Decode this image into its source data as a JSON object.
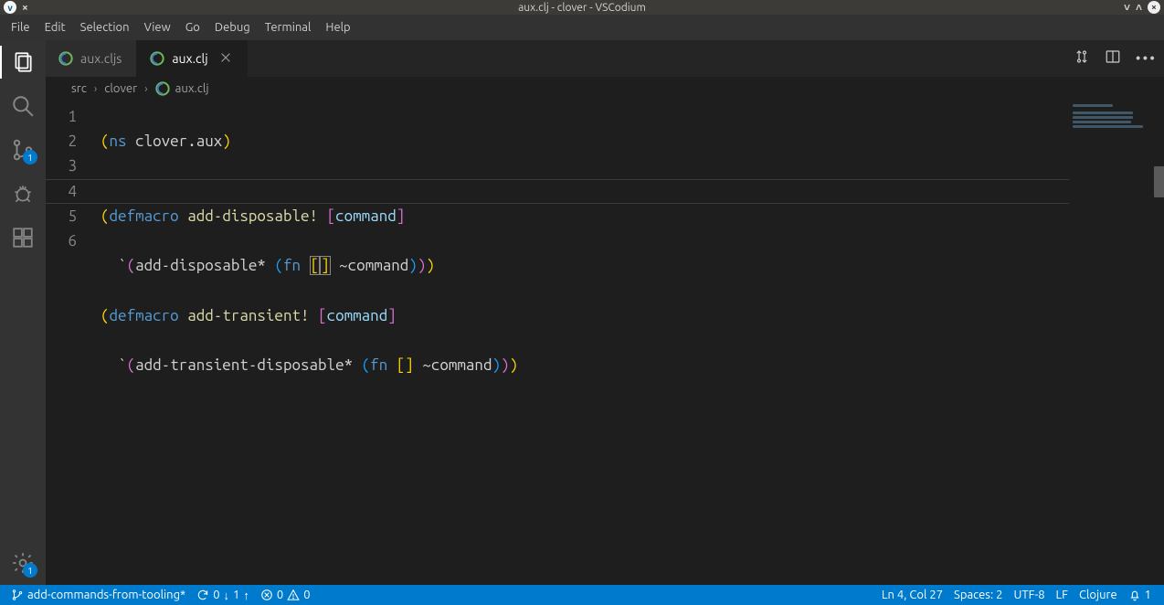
{
  "window": {
    "title": "aux.clj - clover - VSCodium"
  },
  "menu": [
    "File",
    "Edit",
    "Selection",
    "View",
    "Go",
    "Debug",
    "Terminal",
    "Help"
  ],
  "activity": {
    "scm_badge": "1",
    "settings_badge": "1"
  },
  "tabs": [
    {
      "label": "aux.cljs",
      "active": false,
      "icon": "clojure-icon"
    },
    {
      "label": "aux.clj",
      "active": true,
      "icon": "clojure-icon"
    }
  ],
  "breadcrumb": {
    "parts": [
      "src",
      "clover",
      "aux.clj"
    ]
  },
  "code": {
    "lines": {
      "l1": {
        "t1": "(",
        "t2": "ns",
        "t3": " clover.aux",
        "t4": ")"
      },
      "l2": "",
      "l3": {
        "t1": "(",
        "t2": "defmacro",
        "t3": " ",
        "t4": "add-disposable!",
        "t5": " ",
        "t6": "[",
        "t7": "command",
        "t8": "]"
      },
      "l4": {
        "ind": "  ",
        "t1": "`",
        "t2": "(",
        "t3": "add-disposable* ",
        "t4": "(",
        "t5": "fn",
        "t6": " ",
        "t7": "[",
        "t8": "]",
        "t9": " ~command",
        "t10": ")",
        "t11": ")",
        "t12": ")"
      },
      "l5": {
        "t1": "(",
        "t2": "defmacro",
        "t3": " ",
        "t4": "add-transient!",
        "t5": " ",
        "t6": "[",
        "t7": "command",
        "t8": "]"
      },
      "l6": {
        "ind": "  ",
        "t1": "`",
        "t2": "(",
        "t3": "add-transient-disposable* ",
        "t4": "(",
        "t5": "fn",
        "t6": " ",
        "t7": "[]",
        "t8": " ~command",
        "t9": ")",
        "t10": ")",
        "t11": ")"
      }
    },
    "line_numbers": [
      "1",
      "2",
      "3",
      "4",
      "5",
      "6"
    ]
  },
  "status": {
    "branch": "add-commands-from-tooling*",
    "sync": {
      "down": "0",
      "down_arrow": "↓",
      "up": "1",
      "up_arrow": "↑"
    },
    "errors": "0",
    "warnings": "0",
    "cursor": "Ln 4, Col 27",
    "indent": "Spaces: 2",
    "encoding": "UTF-8",
    "eol": "LF",
    "language": "Clojure",
    "notifications": "1"
  },
  "colors": {
    "accent": "#007acc"
  }
}
